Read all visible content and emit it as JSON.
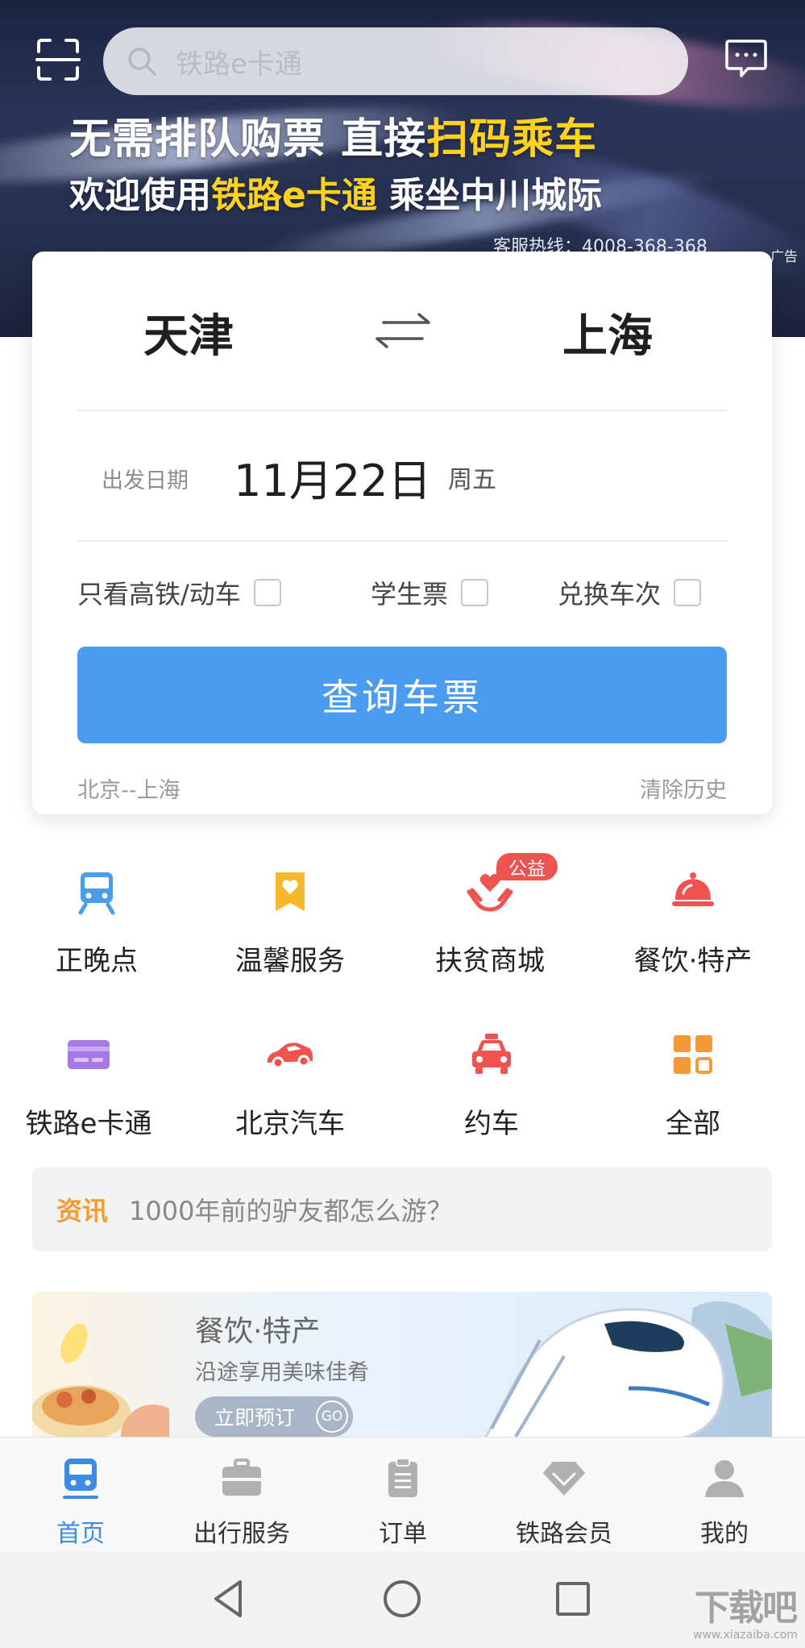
{
  "header": {
    "search_placeholder": "铁路e卡通",
    "icons": {
      "scan": "scan-icon",
      "search": "search-icon",
      "message": "message-icon"
    }
  },
  "hero_banner": {
    "line1_part1": "无需排队购票 直接",
    "line1_highlight": "扫码乘车",
    "line2_part1": "欢迎使用",
    "line2_highlight": "铁路e卡通",
    "line2_part2": " 乘坐中川城际",
    "hotline": "客服热线：4008-368-368",
    "ad_label": "广告",
    "highlight_color": "#ffd21e"
  },
  "ticket_search": {
    "from_city": "天津",
    "to_city": "上海",
    "swap_icon": "swap-arrows-icon",
    "date_label": "出发日期",
    "date_value": "11月22日",
    "weekday": "周五",
    "options": [
      {
        "label": "只看高铁/动车",
        "checked": false
      },
      {
        "label": "学生票",
        "checked": false
      },
      {
        "label": "兑换车次",
        "checked": false
      }
    ],
    "query_button": "查询车票",
    "history_item": "北京--上海",
    "clear_history": "清除历史",
    "accent_color": "#4b9cf1"
  },
  "services": [
    {
      "label": "正晚点",
      "icon": "train-icon",
      "color": "#4a9de8"
    },
    {
      "label": "温馨服务",
      "icon": "bookmark-heart-icon",
      "color": "#f5b82e"
    },
    {
      "label": "扶贫商城",
      "icon": "hands-heart-icon",
      "color": "#ef5350",
      "badge": "公益"
    },
    {
      "label": "餐饮·特产",
      "icon": "food-cloche-icon",
      "color": "#ef5350"
    },
    {
      "label": "铁路e卡通",
      "icon": "card-icon",
      "color": "#a678e8"
    },
    {
      "label": "北京汽车",
      "icon": "sports-car-icon",
      "color": "#ef5350"
    },
    {
      "label": "约车",
      "icon": "taxi-icon",
      "color": "#ef5350"
    },
    {
      "label": "全部",
      "icon": "grid-all-icon",
      "color": "#f59a3a"
    }
  ],
  "news": {
    "tag": "资讯",
    "text": "1000年前的驴友都怎么游？"
  },
  "promo": {
    "title": "餐饮·特产",
    "subtitle": "沿途享用美味佳肴",
    "button": "立即预订",
    "button_go": "GO"
  },
  "tabbar": {
    "items": [
      {
        "label": "首页",
        "icon": "home-train-icon",
        "active": true
      },
      {
        "label": "出行服务",
        "icon": "briefcase-icon",
        "active": false
      },
      {
        "label": "订单",
        "icon": "clipboard-icon",
        "active": false
      },
      {
        "label": "铁路会员",
        "icon": "diamond-icon",
        "active": false
      },
      {
        "label": "我的",
        "icon": "person-icon",
        "active": false
      }
    ],
    "active_color": "#3d8be6"
  },
  "system_nav": {
    "back": "back-triangle-icon",
    "home": "home-circle-icon",
    "recents": "recents-square-icon"
  },
  "watermark": {
    "text": "下载吧",
    "url": "www.xiazaiba.com"
  }
}
